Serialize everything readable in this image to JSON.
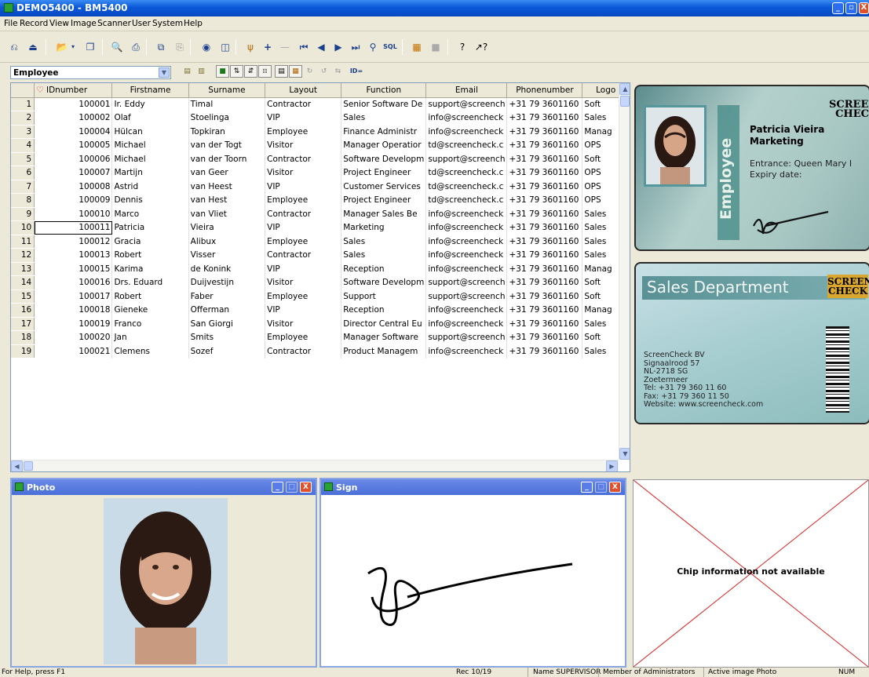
{
  "window": {
    "title": "DEMO5400 - BM5400",
    "min": "_",
    "max": "▫",
    "close": "X"
  },
  "menu": [
    "File",
    "Record",
    "View",
    "Image",
    "Scanner",
    "User",
    "System",
    "Help"
  ],
  "toolbar": {
    "sql_label": "SQL",
    "id_label": "ID="
  },
  "layout_select": {
    "value": "Employee"
  },
  "grid": {
    "columns": [
      "IDnumber",
      "Firstname",
      "Surname",
      "Layout",
      "Function",
      "Email",
      "Phonenumber",
      "Logo"
    ],
    "selected_row": 10,
    "rows": [
      [
        "1",
        "100001",
        "Ir. Eddy",
        "Timal",
        "Contractor",
        "Senior Software De",
        "support@screench",
        "+31 79 3601160",
        "Soft"
      ],
      [
        "2",
        "100002",
        "Olaf",
        "Stoelinga",
        "VIP",
        "Sales",
        "info@screencheck",
        "+31 79 3601160",
        "Sales"
      ],
      [
        "3",
        "100004",
        "Hülcan",
        "Topkiran",
        "Employee",
        "Finance Administr",
        "info@screencheck",
        "+31 79 3601160",
        "Manag"
      ],
      [
        "4",
        "100005",
        "Michael",
        "van der Togt",
        "Visitor",
        "Manager Operatior",
        "td@screencheck.c",
        "+31 79 3601160",
        "OPS"
      ],
      [
        "5",
        "100006",
        "Michael",
        "van der Toorn",
        "Contractor",
        "Software Developm",
        "support@screench",
        "+31 79 3601160",
        "Soft"
      ],
      [
        "6",
        "100007",
        "Martijn",
        "van Geer",
        "Visitor",
        "Project Engineer",
        "td@screencheck.c",
        "+31 79 3601160",
        "OPS"
      ],
      [
        "7",
        "100008",
        "Astrid",
        "van Heest",
        "VIP",
        "Customer Services",
        "td@screencheck.c",
        "+31 79 3601160",
        "OPS"
      ],
      [
        "8",
        "100009",
        "Dennis",
        "van Hest",
        "Employee",
        "Project Engineer",
        "td@screencheck.c",
        "+31 79 3601160",
        "OPS"
      ],
      [
        "9",
        "100010",
        "Marco",
        "van Vliet",
        "Contractor",
        "Manager Sales Be",
        "info@screencheck",
        "+31 79 3601160",
        "Sales"
      ],
      [
        "10",
        "100011",
        "Patricia",
        "Vieira",
        "VIP",
        "Marketing",
        "info@screencheck",
        "+31 79 3601160",
        "Sales"
      ],
      [
        "11",
        "100012",
        "Gracia",
        "Alibux",
        "Employee",
        "Sales",
        "info@screencheck",
        "+31 79 3601160",
        "Sales"
      ],
      [
        "12",
        "100013",
        "Robert",
        "Visser",
        "Contractor",
        "Sales",
        "info@screencheck",
        "+31 79 3601160",
        "Sales"
      ],
      [
        "13",
        "100015",
        "Karima",
        "de Konink",
        "VIP",
        "Reception",
        "info@screencheck",
        "+31 79 3601160",
        "Manag"
      ],
      [
        "14",
        "100016",
        "Drs. Eduard",
        "Duijvestijn",
        "Visitor",
        "Software Developm",
        "support@screench",
        "+31 79 3601160",
        "Soft"
      ],
      [
        "15",
        "100017",
        "Robert",
        "Faber",
        "Employee",
        "Support",
        "support@screench",
        "+31 79 3601160",
        "Soft"
      ],
      [
        "16",
        "100018",
        "Gieneke",
        "Offerman",
        "VIP",
        "Reception",
        "info@screencheck",
        "+31 79 3601160",
        "Manag"
      ],
      [
        "17",
        "100019",
        "Franco",
        "San Giorgi",
        "Visitor",
        "Director Central Eu",
        "info@screencheck",
        "+31 79 3601160",
        "Sales"
      ],
      [
        "18",
        "100020",
        "Jan",
        "Smits",
        "Employee",
        "Manager Software",
        "support@screench",
        "+31 79 3601160",
        "Soft"
      ],
      [
        "19",
        "100021",
        "Clemens",
        "Sozef",
        "Contractor",
        "Product Managem",
        "info@screencheck",
        "+31 79 3601160",
        "Sales"
      ]
    ]
  },
  "card_front": {
    "role": "Employee",
    "name": "Patricia Vieira",
    "function": "Marketing",
    "entrance": "Entrance: Queen Mary I",
    "expiry": "Expiry date:",
    "logo_top": "SCREEN",
    "logo_bottom": "CHECK"
  },
  "card_back": {
    "header": "Sales Department",
    "logo_top": "SCREEN",
    "logo_bottom": "CHECK",
    "address": [
      "ScreenCheck BV",
      "Signaalrood 57",
      "NL-2718 SG",
      "Zoetermeer",
      "Tel: +31 79 360 11 60",
      "Fax: +31 79 360 11 50",
      "Website: www.screencheck.com"
    ]
  },
  "photo_window": {
    "title": "Photo"
  },
  "sign_window": {
    "title": "Sign"
  },
  "chip": {
    "message": "Chip information not available"
  },
  "status": {
    "help": "For Help, press F1",
    "rec": "Rec  10/19",
    "name": "Name  SUPERVISOR",
    "member": "Member of  Administrators",
    "active": "Active image  Photo",
    "num": "NUM"
  }
}
